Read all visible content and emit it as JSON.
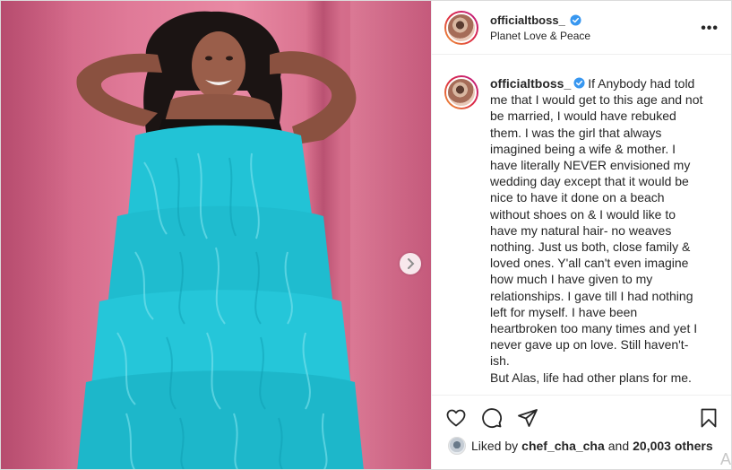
{
  "post": {
    "username": "officialtboss_",
    "location": "Planet Love & Peace",
    "more_icon": "more-options-icon",
    "verified_icon": "verified-badge-icon",
    "media": {
      "description_icon": "photo",
      "next_icon": "chevron-right-icon"
    },
    "caption": {
      "username": "officialtboss_",
      "paragraph1": "If Anybody had told me that I would get to this age and not be married, I would have rebuked them. I was the girl that always imagined being a wife & mother. I have literally NEVER envisioned my wedding day except that it would be nice to have it done on a beach without shoes on & I would like to have my natural hair- no weaves nothing. Just us both, close family & loved ones. Y'all can't even imagine how much I have given to my relationships. I gave till I had nothing left for myself. I have been heartbroken too many times and yet I never gave up on love. Still haven't-ish.",
      "paragraph2": "But Alas, life had other plans for me."
    },
    "actions": {
      "like_icon": "heart-icon",
      "comment_icon": "comment-icon",
      "share_icon": "share-icon",
      "save_icon": "bookmark-icon"
    },
    "likes": {
      "prefix": "Liked by",
      "user": "chef_cha_cha",
      "connector": "and",
      "others": "20,003 others"
    },
    "watermark": "A"
  },
  "colors": {
    "verified": "#3897f0",
    "dress": "#22c3d6",
    "backdrop": "#e07a98"
  }
}
